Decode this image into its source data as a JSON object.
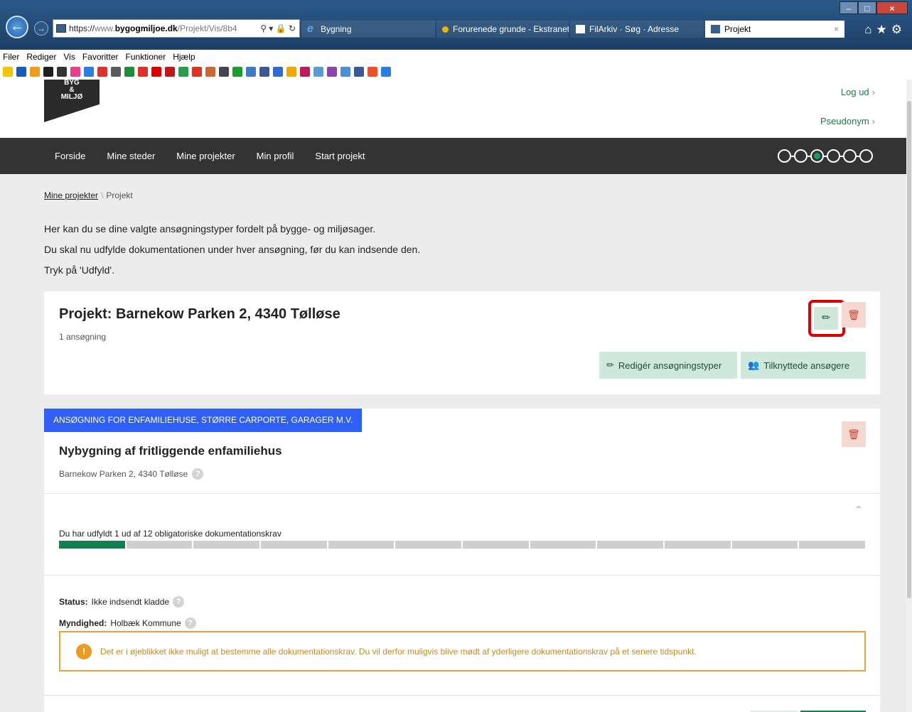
{
  "browser": {
    "url_prefix": "https://",
    "url_grey1": "www.",
    "url_bold": "bygogmiljoe.dk",
    "url_grey2": "/Projekt/Vis/8b4",
    "tabs": [
      {
        "label": "Bygning"
      },
      {
        "label": "Forurenede grunde - Ekstranet"
      },
      {
        "label": "FilArkiv · Søg · Adresse"
      },
      {
        "label": "Projekt"
      }
    ],
    "menu": [
      "Filer",
      "Rediger",
      "Vis",
      "Favoritter",
      "Funktioner",
      "Hjælp"
    ],
    "fav_colors": [
      "#f5c400",
      "#1a5bb8",
      "#f29b1d",
      "#1f1f1f",
      "#333",
      "#e83e8c",
      "#2a7de1",
      "#e0302b",
      "#5a5a5a",
      "#1b8f3c",
      "#e0302b",
      "#d00",
      "#c21818",
      "#2a9d4b",
      "#d32",
      "#c63",
      "#445",
      "#1a9e2e",
      "#3d7cc9",
      "#3b5998",
      "#2f6bd1",
      "#f0a800",
      "#c2185b",
      "#5b9bd5",
      "#8e44ad",
      "#4a90d9",
      "#3b5998",
      "#f25022",
      "#2a7de1"
    ]
  },
  "header": {
    "logo_lines": [
      "BYG",
      "&",
      "MILJØ"
    ],
    "logout": "Log ud",
    "pseudonym": "Pseudonym"
  },
  "nav": {
    "items": [
      "Forside",
      "Mine steder",
      "Mine projekter",
      "Min profil",
      "Start projekt"
    ],
    "steps_total": 6,
    "steps_current": 3
  },
  "breadcrumb": {
    "link": "Mine projekter",
    "separator": "\\",
    "current": "Projekt"
  },
  "intro": {
    "lines": [
      "Her kan du se dine valgte ansøgningstyper fordelt på bygge- og miljøsager.",
      "Du skal nu udfylde dokumentationen under hver ansøgning, før du kan indsende den.",
      "Tryk på 'Udfyld'."
    ]
  },
  "project": {
    "title": "Projekt: Barnekow Parken 2, 4340 Tølløse",
    "count": "1 ansøgning",
    "edit_types_label": "Redigér ansøgningstyper",
    "applicants_label": "Tilknyttede ansøgere"
  },
  "application": {
    "type_badge": "ANSØGNING FOR ENFAMILIEHUSE, STØRRE CARPORTE, GARAGER M.V.",
    "title": "Nybygning af fritliggende enfamiliehus",
    "address": "Barnekow Parken 2, 4340 Tølløse",
    "progress_text": "Du har udfyldt 1 ud af 12 obligatoriske dokumentationskrav",
    "progress_done": 1,
    "progress_total": 12,
    "status_label": "Status:",
    "status_value": "Ikke indsendt kladde",
    "authority_label": "Myndighed:",
    "authority_value": "Holbæk Kommune",
    "warning": "Det er i øjeblikket ikke muligt at bestemme alle dokumentationskrav. Du vil derfor muligvis blive mødt af yderligere dokumentationskrav på et senere tidspunkt.",
    "colors": {
      "badge": "#2f5ff5",
      "progress_done": "#12804f",
      "warning": "#e6a23c"
    }
  }
}
